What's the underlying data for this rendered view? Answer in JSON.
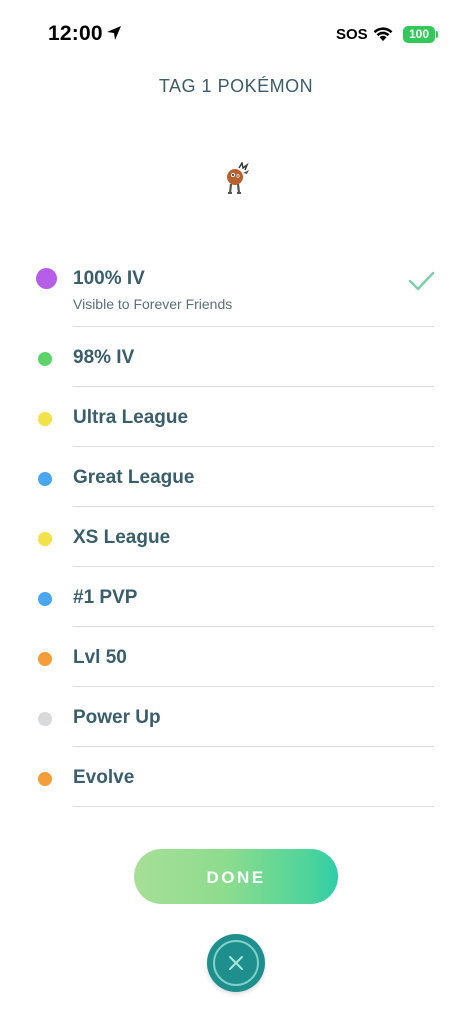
{
  "status_bar": {
    "time": "12:00",
    "carrier": "SOS",
    "battery": "100",
    "battery_color": "#34c759"
  },
  "title": "TAG 1 POKÉMON",
  "icons": {
    "location": "location-arrow-icon",
    "wifi": "wifi-icon",
    "check": "checkmark-icon",
    "close": "close-icon"
  },
  "tags": [
    {
      "label": "100% IV",
      "subtitle": "Visible to Forever Friends",
      "color": "#b65ee8",
      "selected": true
    },
    {
      "label": "98% IV",
      "color": "#5dd36a",
      "selected": false
    },
    {
      "label": "Ultra League",
      "color": "#f1e14a",
      "selected": false
    },
    {
      "label": "Great League",
      "color": "#4aa6ee",
      "selected": false
    },
    {
      "label": "XS League",
      "color": "#f1e14a",
      "selected": false
    },
    {
      "label": "#1 PVP",
      "color": "#4aa6ee",
      "selected": false
    },
    {
      "label": "Lvl 50",
      "color": "#f59d3d",
      "selected": false
    },
    {
      "label": "Power Up",
      "color": "#d7d9da",
      "selected": false
    },
    {
      "label": "Evolve",
      "color": "#f59d3d",
      "selected": false
    }
  ],
  "done_label": "DONE",
  "accent_color": "#1f8f8e"
}
